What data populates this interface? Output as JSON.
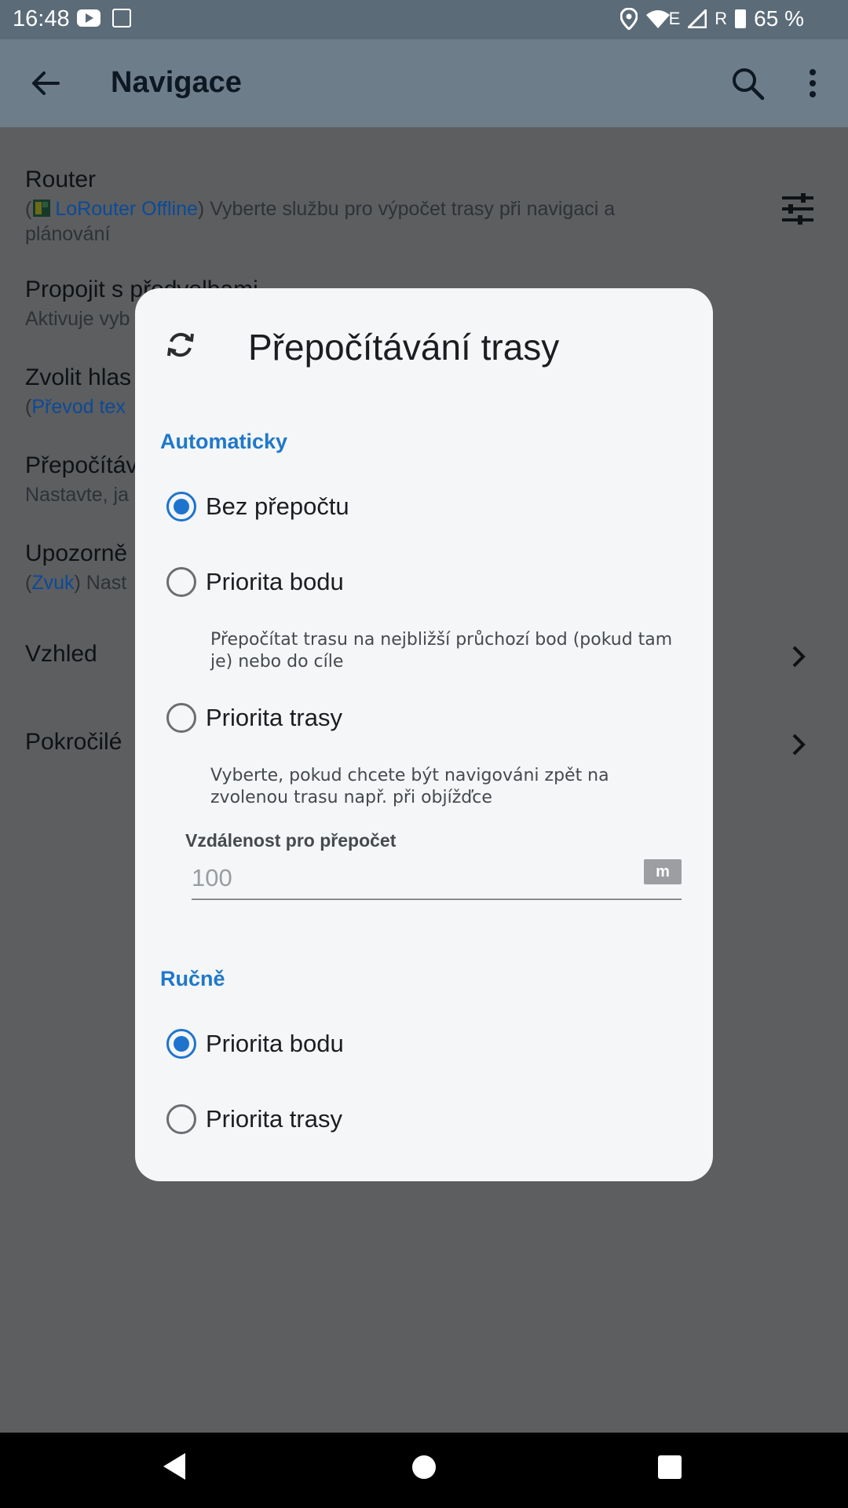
{
  "status_bar": {
    "time": "16:48",
    "network": "E",
    "roaming": "R",
    "battery": "65 %"
  },
  "app_bar": {
    "title": "Navigace"
  },
  "settings": {
    "router": {
      "title": "Router",
      "open_paren": "(",
      "link": "LoRouter Offline",
      "subtitle_rest": ") Vyberte službu pro výpočet trasy při navigaci a",
      "subtitle_line2": "plánování"
    },
    "connect": {
      "title": "Propojit s předvolbami",
      "subtitle": "Aktivuje vyb"
    },
    "voice": {
      "title": "Zvolit hlas",
      "open_paren": "(",
      "link": "Převod tex"
    },
    "recalc": {
      "title": "Přepočítáv",
      "subtitle": "Nastavte, ja"
    },
    "warnings": {
      "title": "Upozorně",
      "open_paren": "(",
      "link": "Zvuk",
      "subtitle_rest": ") Nast"
    },
    "appearance": {
      "title": "Vzhled"
    },
    "advanced": {
      "title": "Pokročilé"
    }
  },
  "dialog": {
    "title": "Přepočítávání trasy",
    "auto_section": "Automaticky",
    "auto_options": [
      {
        "label": "Bez přepočtu",
        "selected": true,
        "description": ""
      },
      {
        "label": "Priorita bodu",
        "selected": false,
        "description": "Přepočítat trasu na nejbližší průchozí bod (pokud tam je) nebo do cíle"
      },
      {
        "label": "Priorita trasy",
        "selected": false,
        "description": "Vyberte, pokud chcete být navigováni zpět na zvolenou trasu např. při objížďce"
      }
    ],
    "distance_label": "Vzdálenost pro přepočet",
    "distance_value": "100",
    "distance_unit": "m",
    "manual_section": "Ručně",
    "manual_options": [
      {
        "label": "Priorita bodu",
        "selected": true
      },
      {
        "label": "Priorita trasy",
        "selected": false
      }
    ]
  },
  "colors": {
    "accent": "#1e74cc",
    "app_bar": "#6d7d89",
    "scrim": "#5c5e60"
  }
}
